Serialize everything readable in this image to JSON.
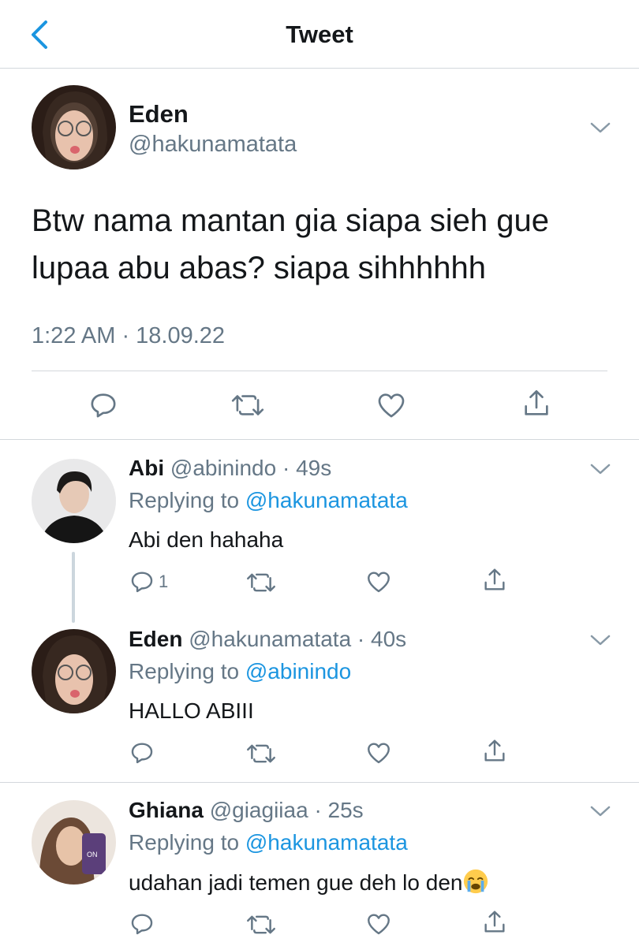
{
  "header": {
    "title": "Tweet",
    "back_icon": "chevron-left-icon"
  },
  "colors": {
    "link": "#1b95e0",
    "muted": "#657786",
    "divider": "#d3d8dc"
  },
  "main_tweet": {
    "name": "Eden",
    "handle": "@hakunamatata",
    "text": "Btw nama mantan gia siapa sieh gue lupaa abu abas? siapa sihhhhhh",
    "timestamp": "1:22 AM · 18.09.22"
  },
  "replies": [
    {
      "name": "Abi",
      "handle": "@abinindo",
      "time": "· 49s",
      "replying_prefix": "Replying to",
      "replying_to": "@hakunamatata",
      "text": "Abi den hahaha",
      "reply_count": "1"
    },
    {
      "name": "Eden",
      "handle": "@hakunamatata",
      "time": "· 40s",
      "replying_prefix": "Replying to",
      "replying_to": "@abinindo",
      "text": "HALLO ABIII",
      "reply_count": ""
    },
    {
      "name": "Ghiana",
      "handle": "@giagiiaa",
      "time": "· 25s",
      "replying_prefix": "Replying to",
      "replying_to": "@hakunamatata",
      "text": "udahan jadi temen gue deh lo den",
      "emoji": "crying-face-emoji",
      "reply_count": ""
    }
  ]
}
